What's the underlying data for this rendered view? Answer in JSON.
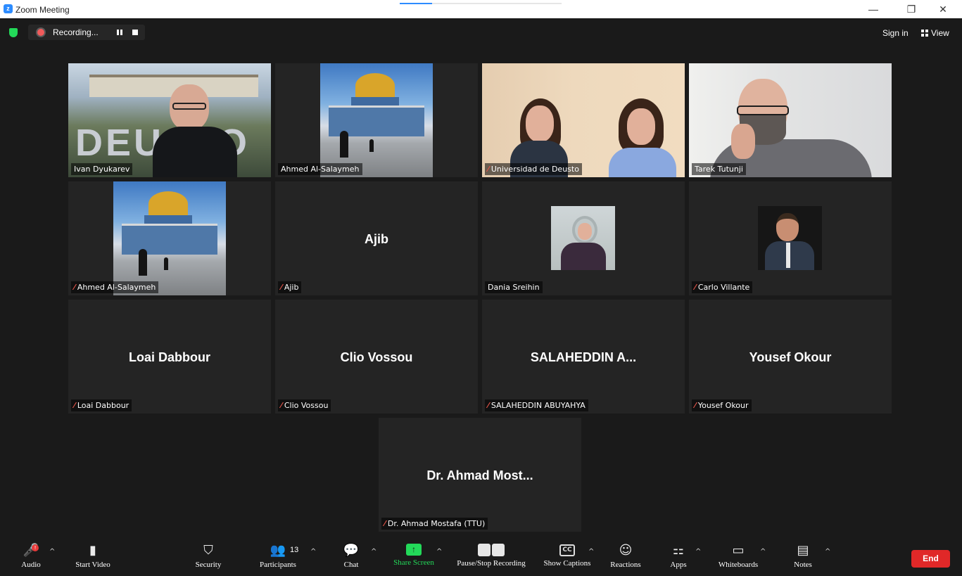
{
  "window": {
    "title": "Zoom Meeting",
    "minimize": "—",
    "restore": "❐",
    "close": "✕"
  },
  "topbar": {
    "recording_label": "Recording...",
    "sign_in": "Sign in",
    "view": "View"
  },
  "tiles": [
    {
      "name": "Ivan Dyukarev",
      "muted": false,
      "center_name": ""
    },
    {
      "name": "Ahmed Al-Salaymeh",
      "muted": false,
      "center_name": ""
    },
    {
      "name": "Universidad de Deusto",
      "muted": true,
      "center_name": ""
    },
    {
      "name": "Tarek Tutunji",
      "muted": false,
      "center_name": ""
    },
    {
      "name": "Ahmed Al-Salaymeh",
      "muted": true,
      "center_name": ""
    },
    {
      "name": "Ajib",
      "muted": true,
      "center_name": "Ajib"
    },
    {
      "name": "Dania Sreihin",
      "muted": false,
      "center_name": ""
    },
    {
      "name": "Carlo Villante",
      "muted": true,
      "center_name": ""
    },
    {
      "name": "Loai Dabbour",
      "muted": true,
      "center_name": "Loai Dabbour"
    },
    {
      "name": "Clio Vossou",
      "muted": true,
      "center_name": "Clio Vossou"
    },
    {
      "name": "SALAHEDDIN ABUYAHYA",
      "muted": true,
      "center_name": "SALAHEDDIN  A..."
    },
    {
      "name": "Yousef Okour",
      "muted": true,
      "center_name": "Yousef Okour"
    },
    {
      "name": "Dr. Ahmad Mostafa (TTU)",
      "muted": true,
      "center_name": "Dr. Ahmad Most..."
    }
  ],
  "mic_muted_glyph": "⁄",
  "toolbar": {
    "audio": "Audio",
    "audio_badge": "!",
    "start_video": "Start Video",
    "security": "Security",
    "participants": "Participants",
    "participants_count": "13",
    "chat": "Chat",
    "share_screen": "Share Screen",
    "pause_stop_recording": "Pause/Stop Recording",
    "show_captions": "Show Captions",
    "captions_badge": "CC",
    "reactions": "Reactions",
    "apps": "Apps",
    "whiteboards": "Whiteboards",
    "notes": "Notes",
    "end": "End"
  },
  "icons": {
    "audio": "🎤",
    "video_off": "▮",
    "security": "⛉",
    "participants": "👥",
    "chat": "💬",
    "share": "↑",
    "reactions": "☺",
    "apps": "⚏",
    "whiteboards": "▭",
    "notes": "▤",
    "caret": "^"
  },
  "colors": {
    "accent_green": "#23d959",
    "end_red": "#e02828",
    "active_speaker": "#e8e39a",
    "mute_red": "#e8554a"
  }
}
